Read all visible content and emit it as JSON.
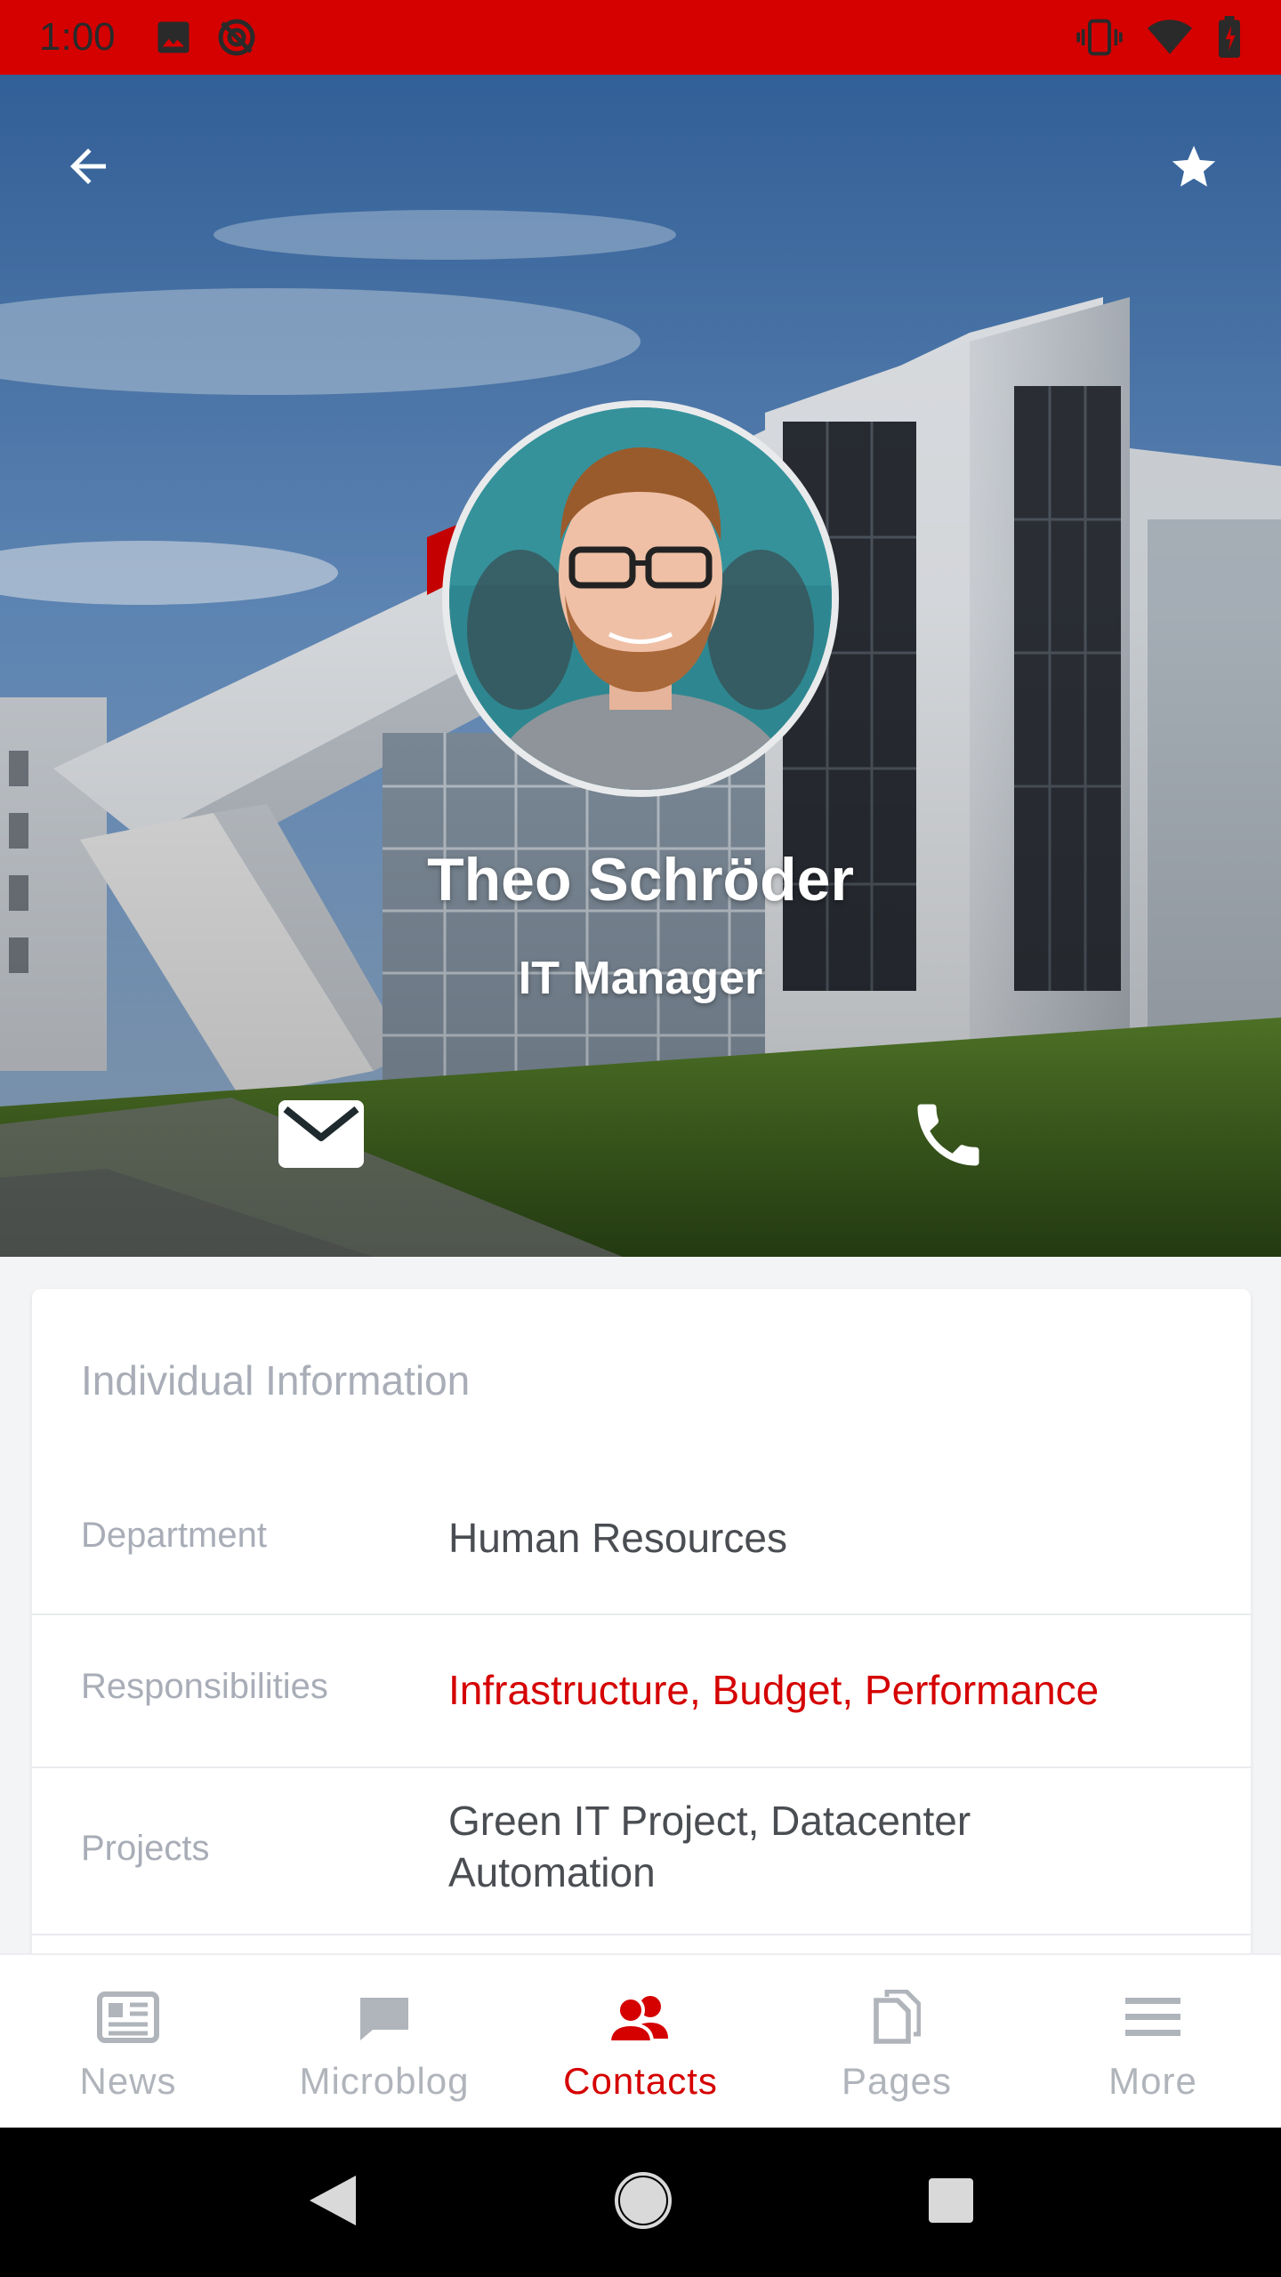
{
  "status_bar": {
    "time": "1:00",
    "left_icons": [
      "image-icon",
      "no-sync-icon"
    ],
    "right_icons": [
      "vibrate-icon",
      "wifi-icon",
      "battery-icon"
    ],
    "background": "#d50000"
  },
  "profile": {
    "name": "Theo Schröder",
    "role": "IT Manager"
  },
  "actions": {
    "back_icon": "arrow-back-icon",
    "favorite_icon": "star-icon",
    "email_icon": "mail-icon",
    "phone_icon": "phone-icon"
  },
  "info_card": {
    "title": "Individual Information",
    "rows": [
      {
        "label": "Department",
        "value": "Human Resources"
      },
      {
        "label": "Responsibilities",
        "value": "Infrastructure, Budget, Performance"
      },
      {
        "label": "Projects",
        "value": "Green IT Project, Datacenter Automation"
      }
    ]
  },
  "bottom_nav": {
    "items": [
      {
        "label": "News",
        "icon": "news-icon",
        "active": false
      },
      {
        "label": "Microblog",
        "icon": "chat-icon",
        "active": false
      },
      {
        "label": "Contacts",
        "icon": "contacts-icon",
        "active": true
      },
      {
        "label": "Pages",
        "icon": "pages-icon",
        "active": false
      },
      {
        "label": "More",
        "icon": "menu-icon",
        "active": false
      }
    ]
  },
  "colors": {
    "accent": "#d50000",
    "muted_text": "#a8adb7",
    "value_text": "#4a4d52"
  }
}
